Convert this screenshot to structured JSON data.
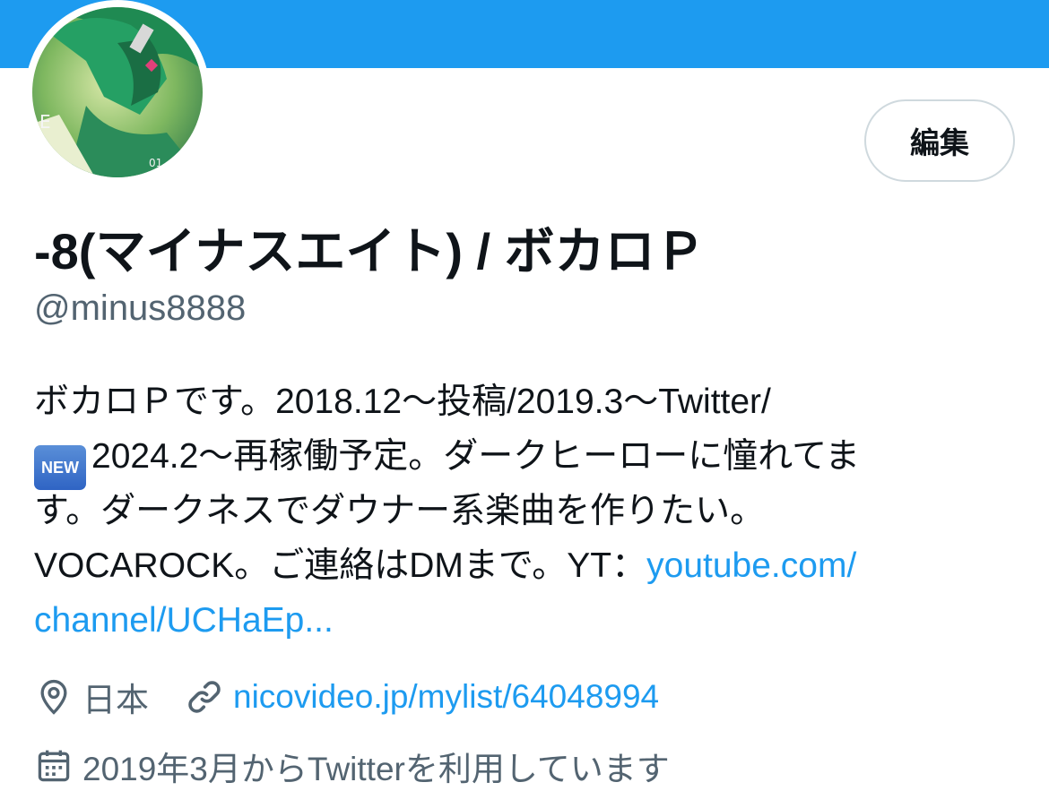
{
  "profile": {
    "display_name": "-8(マイナスエイト) / ボカロＰ",
    "handle": "@minus8888",
    "edit_label": "編集",
    "bio": {
      "line1": "ボカロＰです。2018.12～投稿/2019.3～Twitter/",
      "new_badge": "NEW",
      "line2": "2024.2～再稼働予定。ダークヒーローに憧れてま",
      "line3": "す。ダークネスでダウナー系楽曲を作りたい。",
      "line4_text": "VOCAROCK。ご連絡はDMまで。YT：",
      "line4_link": "youtube.com/",
      "line5_link": "channel/UCHaEp..."
    },
    "location": "日本",
    "website": "nicovideo.jp/mylist/64048994",
    "joined": "2019年3月からTwitterを利用しています"
  },
  "colors": {
    "banner": "#1d9bf0",
    "link": "#1d9bf0",
    "secondary_text": "#536471",
    "primary_text": "#0f1419"
  },
  "icons": {
    "location": "location-pin-icon",
    "website": "link-icon",
    "joined": "calendar-icon"
  }
}
